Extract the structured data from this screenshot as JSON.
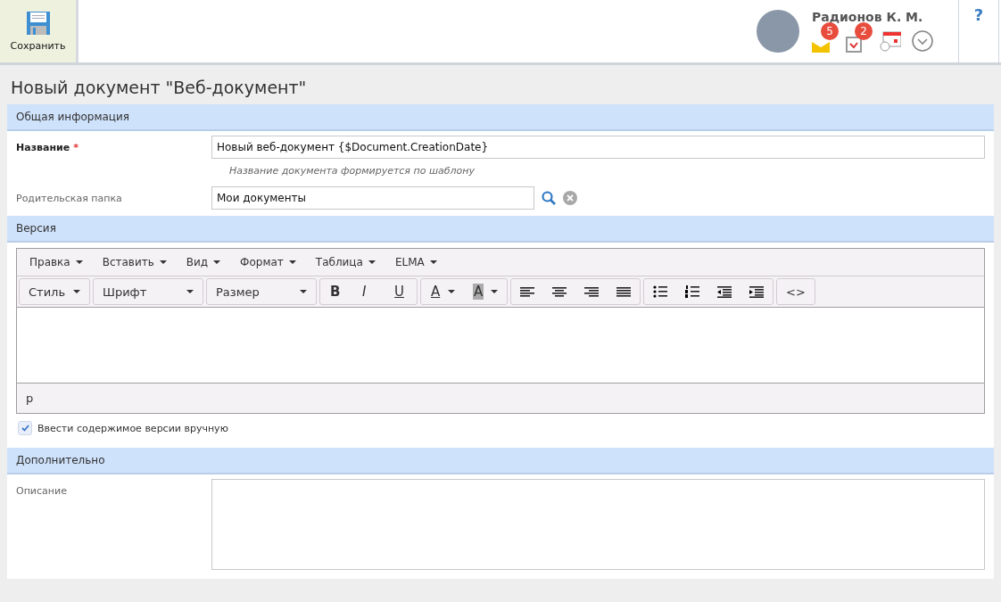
{
  "toolbar": {
    "save_label": "Сохранить"
  },
  "user": {
    "name": "Радионов К. М.",
    "messages_count": "5",
    "tasks_count": "2"
  },
  "help": "?",
  "page_title": "Новый документ \"Веб-документ\"",
  "general": {
    "header": "Общая информация",
    "name_label": "Название",
    "required_mark": "*",
    "name_value": "Новый веб-документ {$Document.CreationDate}",
    "name_hint": "Название документа формируется по шаблону",
    "folder_label": "Родительская папка",
    "folder_value": "Мои документы"
  },
  "version": {
    "header": "Версия",
    "menus": [
      "Правка",
      "Вставить",
      "Вид",
      "Формат",
      "Таблица",
      "ELMA"
    ],
    "groups": [
      [
        {
          "kind": "select",
          "label": "Стиль"
        }
      ],
      [
        {
          "kind": "select",
          "label": "Шрифт"
        }
      ],
      [
        {
          "kind": "select",
          "label": "Размер"
        }
      ],
      [
        {
          "kind": "bold",
          "label": "B"
        },
        {
          "kind": "italic",
          "label": "I"
        },
        {
          "kind": "underline",
          "label": "U"
        }
      ],
      [
        {
          "kind": "forecolor",
          "label": "A"
        },
        {
          "kind": "backcolor",
          "label": "A"
        }
      ],
      [
        {
          "kind": "align-left"
        },
        {
          "kind": "align-center"
        },
        {
          "kind": "align-right"
        },
        {
          "kind": "align-justify"
        }
      ],
      [
        {
          "kind": "bullet-list"
        },
        {
          "kind": "number-list"
        },
        {
          "kind": "outdent"
        },
        {
          "kind": "indent"
        }
      ],
      [
        {
          "kind": "code",
          "label": "<>"
        }
      ]
    ],
    "path": "p",
    "manual": {
      "label": "Ввести содержимое версии вручную",
      "checked": true
    }
  },
  "extra": {
    "header": "Дополнительно",
    "description_label": "Описание"
  }
}
